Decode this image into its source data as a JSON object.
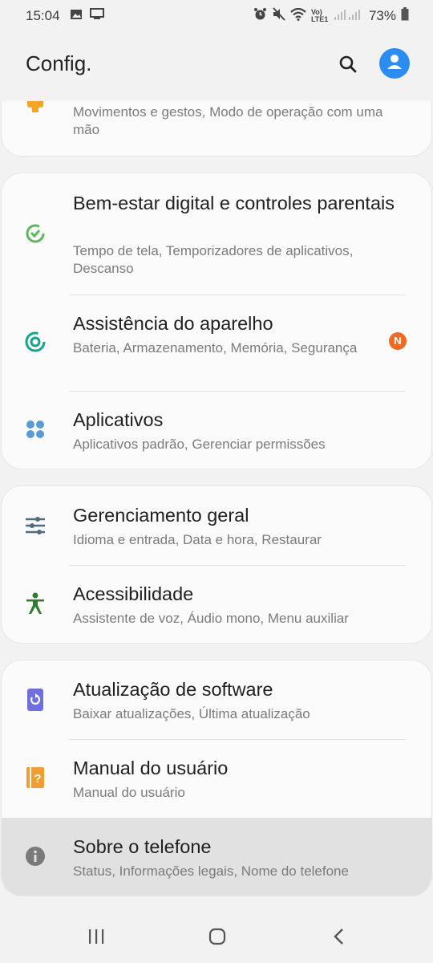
{
  "status_bar": {
    "time": "15:04",
    "battery": "73%",
    "network": "Vo) LTE1",
    "icons": [
      "image-icon",
      "cast-icon",
      "alarm-icon",
      "mute-icon",
      "wifi-icon",
      "signal-icon",
      "battery-icon"
    ]
  },
  "app_bar": {
    "title": "Config."
  },
  "partial_card": {
    "subtitle": "Movimentos e gestos, Modo de operação com uma mão"
  },
  "card1": {
    "items": [
      {
        "title": "Bem-estar digital e controles parentais",
        "subtitle": "Tempo de tela, Temporizadores de aplicativos, Descanso",
        "icon": "digital-wellbeing-icon"
      },
      {
        "title": "Assistência do aparelho",
        "subtitle": "Bateria, Armazenamento, Memória, Segurança",
        "icon": "device-care-icon",
        "badge": "N"
      },
      {
        "title": "Aplicativos",
        "subtitle": "Aplicativos padrão, Gerenciar permissões",
        "icon": "apps-icon"
      }
    ]
  },
  "card2": {
    "items": [
      {
        "title": "Gerenciamento geral",
        "subtitle": "Idioma e entrada, Data e hora, Restaurar",
        "icon": "sliders-icon"
      },
      {
        "title": "Acessibilidade",
        "subtitle": "Assistente de voz, Áudio mono, Menu auxiliar",
        "icon": "accessibility-icon"
      }
    ]
  },
  "card3": {
    "items": [
      {
        "title": "Atualização de software",
        "subtitle": "Baixar atualizações, Última atualização",
        "icon": "software-update-icon"
      },
      {
        "title": "Manual do usuário",
        "subtitle": "Manual do usuário",
        "icon": "user-manual-icon"
      },
      {
        "title": "Sobre o telefone",
        "subtitle": "Status, Informações legais, Nome do telefone",
        "icon": "info-icon"
      }
    ]
  },
  "colors": {
    "accent_blue": "#2d8cf0",
    "wellbeing_green": "#5cb85c",
    "device_care_teal": "#17a589",
    "apps_blue": "#5b9bd5",
    "general_slate": "#4f6d80",
    "accessibility_green": "#2e7d32",
    "update_purple": "#6f6fe0",
    "manual_orange": "#f39c34",
    "info_gray": "#7a7a7a",
    "badge_orange": "#f26a21"
  }
}
